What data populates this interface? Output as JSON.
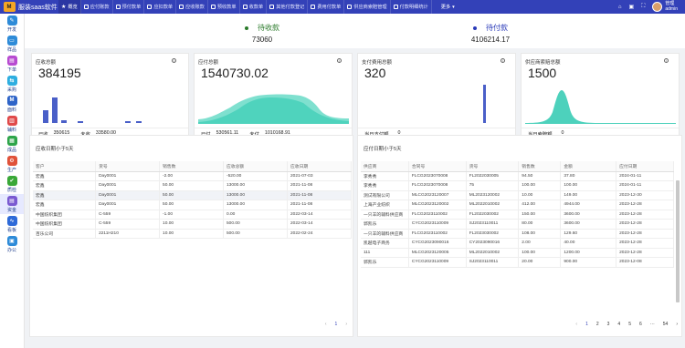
{
  "app": {
    "name": "服装saas软件",
    "logo": "M"
  },
  "tabs": [
    {
      "label": "概览",
      "icon": "star-icon"
    },
    {
      "label": "应付账款",
      "icon": "doc-icon"
    },
    {
      "label": "预付款单",
      "icon": "doc-icon"
    },
    {
      "label": "应扣款单",
      "icon": "doc-icon"
    },
    {
      "label": "应收账款",
      "icon": "doc-icon"
    },
    {
      "label": "预收款单",
      "icon": "doc-icon"
    },
    {
      "label": "收款单",
      "icon": "doc-icon"
    },
    {
      "label": "其他付款登记",
      "icon": "doc-icon"
    },
    {
      "label": "费用付款单",
      "icon": "doc-icon"
    },
    {
      "label": "供应商索赔管理",
      "icon": "doc-icon"
    },
    {
      "label": "付款明细统计",
      "icon": "doc-icon"
    }
  ],
  "more_label": "更多",
  "user": {
    "line1": "管理",
    "line2": "admin"
  },
  "sidebar": [
    {
      "label": "开发",
      "color": "#2e8bd8",
      "glyph": "✎"
    },
    {
      "label": "样品",
      "color": "#2e8bd8",
      "glyph": "▭"
    },
    {
      "label": "下单",
      "color": "#b84bd1",
      "glyph": "▤"
    },
    {
      "label": "采购",
      "color": "#2eaee0",
      "glyph": "⇆"
    },
    {
      "label": "面料",
      "color": "#2e64c8",
      "glyph": "M"
    },
    {
      "label": "辅料",
      "color": "#e04a4a",
      "glyph": "▥"
    },
    {
      "label": "成品",
      "color": "#2ea54a",
      "glyph": "▦"
    },
    {
      "label": "生产",
      "color": "#e0523a",
      "glyph": "⚙"
    },
    {
      "label": "质检",
      "color": "#3aa838",
      "glyph": "✔"
    },
    {
      "label": "资金",
      "color": "#7a5ad1",
      "glyph": "▤"
    },
    {
      "label": "看板",
      "color": "#2e6ad8",
      "glyph": "∿"
    },
    {
      "label": "办公",
      "color": "#2e8bd8",
      "glyph": "▣"
    }
  ],
  "summary": {
    "receivable": {
      "label": "待收款",
      "value": "73060",
      "dot": "#2a7a2a"
    },
    "payable": {
      "label": "待付款",
      "value": "4106214.17",
      "dot": "#2a3ab8"
    }
  },
  "cards": [
    {
      "title": "应收总额",
      "value": "384195",
      "foot": [
        {
          "k": "已收",
          "v": "350615"
        },
        {
          "k": "未收",
          "v": "33580.00"
        }
      ]
    },
    {
      "title": "应付总额",
      "value": "1540730.02",
      "foot": [
        {
          "k": "已付",
          "v": "530561.11"
        },
        {
          "k": "未付",
          "v": "1010168.91"
        }
      ]
    },
    {
      "title": "支付费用总额",
      "value": "320",
      "foot": [
        {
          "k": "当日支付额",
          "v": "0"
        }
      ]
    },
    {
      "title": "供应商索赔总额",
      "value": "1500",
      "foot": [
        {
          "k": "当日索赔额",
          "v": "0"
        }
      ]
    }
  ],
  "left_panel": {
    "title": "应收日期小于5天",
    "columns": [
      "客户",
      "货号",
      "销售数",
      "应收总额",
      "应收日期"
    ],
    "rows": [
      [
        "宏鑫",
        "Day0001",
        "-2.00",
        "-520.00",
        "2021-07-03"
      ],
      [
        "宏鑫",
        "Day0001",
        "50.00",
        "13000.00",
        "2021-11-08"
      ],
      [
        "宏鑫",
        "Day0001",
        "50.00",
        "13000.00",
        "2021-11-08"
      ],
      [
        "宏鑫",
        "Day0001",
        "50.00",
        "13000.00",
        "2021-11-08"
      ],
      [
        "中国纺织集团",
        "C-559",
        "-1.00",
        "0.00",
        "2022-03-14"
      ],
      [
        "中国纺织集团",
        "C-559",
        "10.00",
        "500.00",
        "2022-03-14"
      ],
      [
        "百乐公司",
        "2211H210",
        "10.00",
        "500.00",
        "2022-02-24"
      ]
    ],
    "pager": {
      "prev": "‹",
      "page": "1",
      "next": "›"
    }
  },
  "right_panel": {
    "title": "应付日期小于5天",
    "columns": [
      "供应商",
      "合同号",
      "货号",
      "销售数",
      "金额",
      "应付日期"
    ],
    "rows": [
      [
        "李秀秀",
        "FLCG2023070008",
        "FL2022030005",
        "94.50",
        "37.80",
        "2024-01-11"
      ],
      [
        "李秀秀",
        "FLCG2023070008",
        "75",
        "100.00",
        "100.00",
        "2024-01-11"
      ],
      [
        "测试有限公司",
        "MLCG2023120007",
        "ML2023120002",
        "10.00",
        "149.00",
        "2023-12-30"
      ],
      [
        "上海产业纺织",
        "MLCG2023120002",
        "ML2022010002",
        "412.00",
        "4944.00",
        "2023-12-28"
      ],
      [
        "一只羊的辅料供应商",
        "FLCG2023110002",
        "FL2022030002",
        "150.00",
        "3600.00",
        "2023-12-28"
      ],
      [
        "郭凯乐",
        "CYCG2023110009",
        "SJ2023110011",
        "80.00",
        "3600.00",
        "2023-12-28"
      ],
      [
        "一只羊的辅料供应商",
        "FLCG2023110002",
        "FL2023030002",
        "108.00",
        "129.60",
        "2023-12-28"
      ],
      [
        "凯越电子商务",
        "CYCG2023090016",
        "CY2023090016",
        "2.00",
        "40.00",
        "2023-12-28"
      ],
      [
        "111",
        "MLCG2023120005",
        "ML2022010002",
        "100.00",
        "1200.00",
        "2023-12-28"
      ],
      [
        "郭凯乐",
        "CYCG2023110009",
        "SJ2023110011",
        "20.00",
        "900.00",
        "2023-12-08"
      ]
    ],
    "pager": {
      "prev": "‹",
      "pages": [
        "1",
        "2",
        "3",
        "4",
        "5",
        "6"
      ],
      "ellipsis": "···",
      "last": "54",
      "next": "›"
    }
  },
  "colors": {
    "topbar": "#3341b8",
    "accent": "#3341b8",
    "chart_bar": "#4a5fc8",
    "chart_area": "#2ec9b0"
  }
}
